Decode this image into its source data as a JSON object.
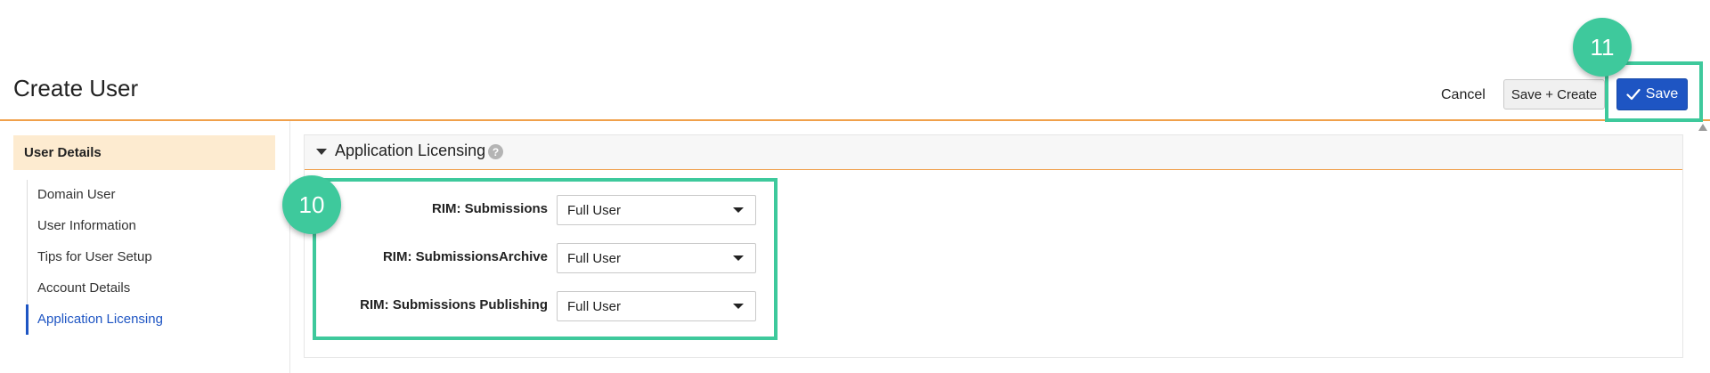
{
  "header": {
    "title": "Create User",
    "cancel_label": "Cancel",
    "save_create_label": "Save + Create",
    "save_label": "Save"
  },
  "sidebar": {
    "header": "User Details",
    "items": [
      {
        "label": "Domain User",
        "active": false
      },
      {
        "label": "User Information",
        "active": false
      },
      {
        "label": "Tips for User Setup",
        "active": false
      },
      {
        "label": "Account Details",
        "active": false
      },
      {
        "label": "Application Licensing",
        "active": true
      }
    ]
  },
  "section": {
    "title": "Application Licensing",
    "help_icon": "?",
    "fields": [
      {
        "label": "RIM: Submissions",
        "value": "Full User"
      },
      {
        "label": "RIM: SubmissionsArchive",
        "value": "Full User"
      },
      {
        "label": "RIM: Submissions Publishing",
        "value": "Full User"
      }
    ]
  },
  "callouts": {
    "fields_badge": "10",
    "save_badge": "11"
  },
  "colors": {
    "accent_orange": "#f0a04b",
    "primary_blue": "#1e55c3",
    "callout_green": "#3ec99c",
    "sidebar_header_bg": "#fdebd0"
  }
}
